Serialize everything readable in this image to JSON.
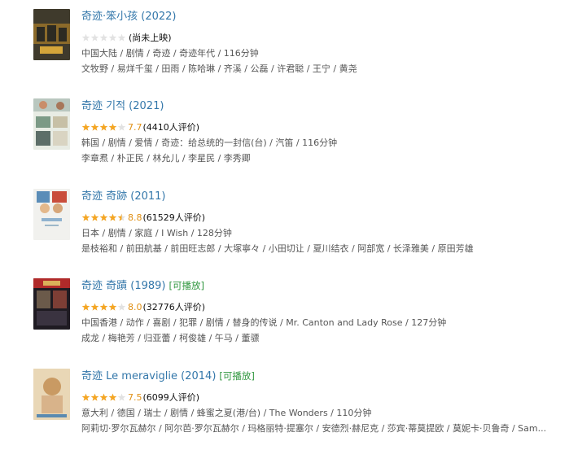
{
  "results": [
    {
      "title": "奇迹·笨小孩 (2022)",
      "playable": "",
      "rating": {
        "score": "",
        "stars": 0,
        "votes": "(尚未上映)"
      },
      "meta": "中国大陆 / 剧情 / 奇迹 / 奇迹年代 / 116分钟",
      "cast": "文牧野 / 易烊千玺 / 田雨 / 陈哈琳 / 齐溪 / 公磊 / 许君聪 / 王宁 / 黄尧",
      "poster_colors": [
        "#3f3a2c",
        "#8b6a2a",
        "#d4a53a",
        "#2c2a22"
      ]
    },
    {
      "title": "奇迹 기적 (2021)",
      "playable": "",
      "rating": {
        "score": "7.7",
        "stars": 4,
        "votes": "(4410人评价)"
      },
      "meta": "韩国 / 剧情 / 爱情 / 奇迹：给总统的一封信(台) / 汽笛 / 116分钟",
      "cast": "李章焄 / 朴正民 / 林允儿 / 李星民 / 李秀卿",
      "poster_colors": [
        "#e8ece4",
        "#7c9a86",
        "#c7c0a6",
        "#5d6e68"
      ]
    },
    {
      "title": "奇迹 奇跡 (2011)",
      "playable": "",
      "rating": {
        "score": "8.8",
        "stars": 4.5,
        "votes": "(61529人评价)"
      },
      "meta": "日本 / 剧情 / 家庭 / I Wish / 128分钟",
      "cast": "是枝裕和 / 前田航基 / 前田旺志郎 / 大塚寧々 / 小田切让 / 夏川结衣 / 阿部宽 / 长泽雅美 / 原田芳雄",
      "poster_colors": [
        "#f1f1ee",
        "#5b8db8",
        "#e3b88b",
        "#c94d3b"
      ]
    },
    {
      "title": "奇迹 奇蹟 (1989)",
      "playable": "[可播放]",
      "rating": {
        "score": "8.0",
        "stars": 4,
        "votes": "(32776人评价)"
      },
      "meta": "中国香港 / 动作 / 喜剧 / 犯罪 / 剧情 / 替身的传说 / Mr. Canton and Lady Rose / 127分钟",
      "cast": "成龙 / 梅艳芳 / 归亚蕾 / 柯俊雄 / 午马 / 董骠",
      "poster_colors": [
        "#1f1b22",
        "#b02a2a",
        "#d9b15a",
        "#3a3340"
      ]
    },
    {
      "title": "奇迹 Le meraviglie (2014)",
      "playable": "[可播放]",
      "rating": {
        "score": "7.5",
        "stars": 4,
        "votes": "(6099人评价)"
      },
      "meta": "意大利 / 德国 / 瑞士 / 剧情 / 蜂蜜之夏(港/台) / The Wonders / 110分钟",
      "cast": "阿莉切·罗尔瓦赫尔 / 阿尔芭·罗尔瓦赫尔 / 玛格丽特·提塞尔 / 安德烈·赫尼克 / 莎宾·蒂莫提欧 / 莫妮卡·贝鲁奇 / Sam...",
      "poster_colors": [
        "#e9d7b6",
        "#c99a63",
        "#5a8ab0",
        "#8a5a3a"
      ]
    }
  ],
  "colors": {
    "link": "#3377aa",
    "star_on": "#f5a623",
    "star_off": "#e2e2e2",
    "score": "#e09015",
    "playable": "#2e963d",
    "meta": "#555555"
  },
  "icons": [
    "movie-poster",
    "rating-star"
  ]
}
